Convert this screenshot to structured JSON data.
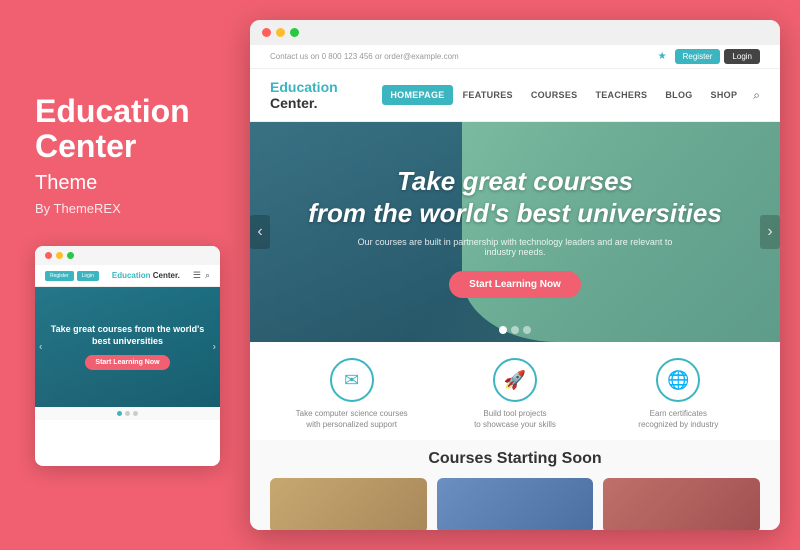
{
  "left": {
    "title_line1": "Education",
    "title_line2": "Center",
    "subtitle": "Theme",
    "author": "By ThemeREX"
  },
  "mobile": {
    "logo": "Education Center.",
    "logo_dot_color": "#3bb5c0",
    "register_btn": "Register",
    "login_btn": "Login",
    "hero_text": "Take great courses from the world's best universities",
    "cta_btn": "Start Learning Now"
  },
  "browser": {
    "dots": [
      "#ff5f57",
      "#febc2e",
      "#28c840"
    ],
    "top_bar": {
      "contact": "Contact us on 0 800 123 456  or  order@example.com",
      "register": "Register",
      "login": "Login"
    },
    "nav": {
      "logo": "Education Center.",
      "menu_items": [
        "HOMEPAGE",
        "FEATURES",
        "COURSES",
        "TEACHERS",
        "BLOG",
        "SHOP"
      ]
    },
    "hero": {
      "title_line1": "Take great courses",
      "title_line2": "from the world's best universities",
      "subtitle": "Our courses are built in partnership with technology leaders and are relevant to industry needs.",
      "cta": "Start Learning Now"
    },
    "features": [
      {
        "icon": "✉",
        "text_line1": "Take computer science courses",
        "text_line2": "with personalized support"
      },
      {
        "icon": "🚀",
        "text_line1": "Build tool projects",
        "text_line2": "to showcase your skills"
      },
      {
        "icon": "🌐",
        "text_line1": "Earn certificates",
        "text_line2": "recognized by industry"
      }
    ],
    "courses_section": {
      "title": "Courses Starting Soon"
    }
  },
  "colors": {
    "teal": "#3bb5c0",
    "pink": "#f06070",
    "white": "#ffffff",
    "dark": "#333333"
  }
}
